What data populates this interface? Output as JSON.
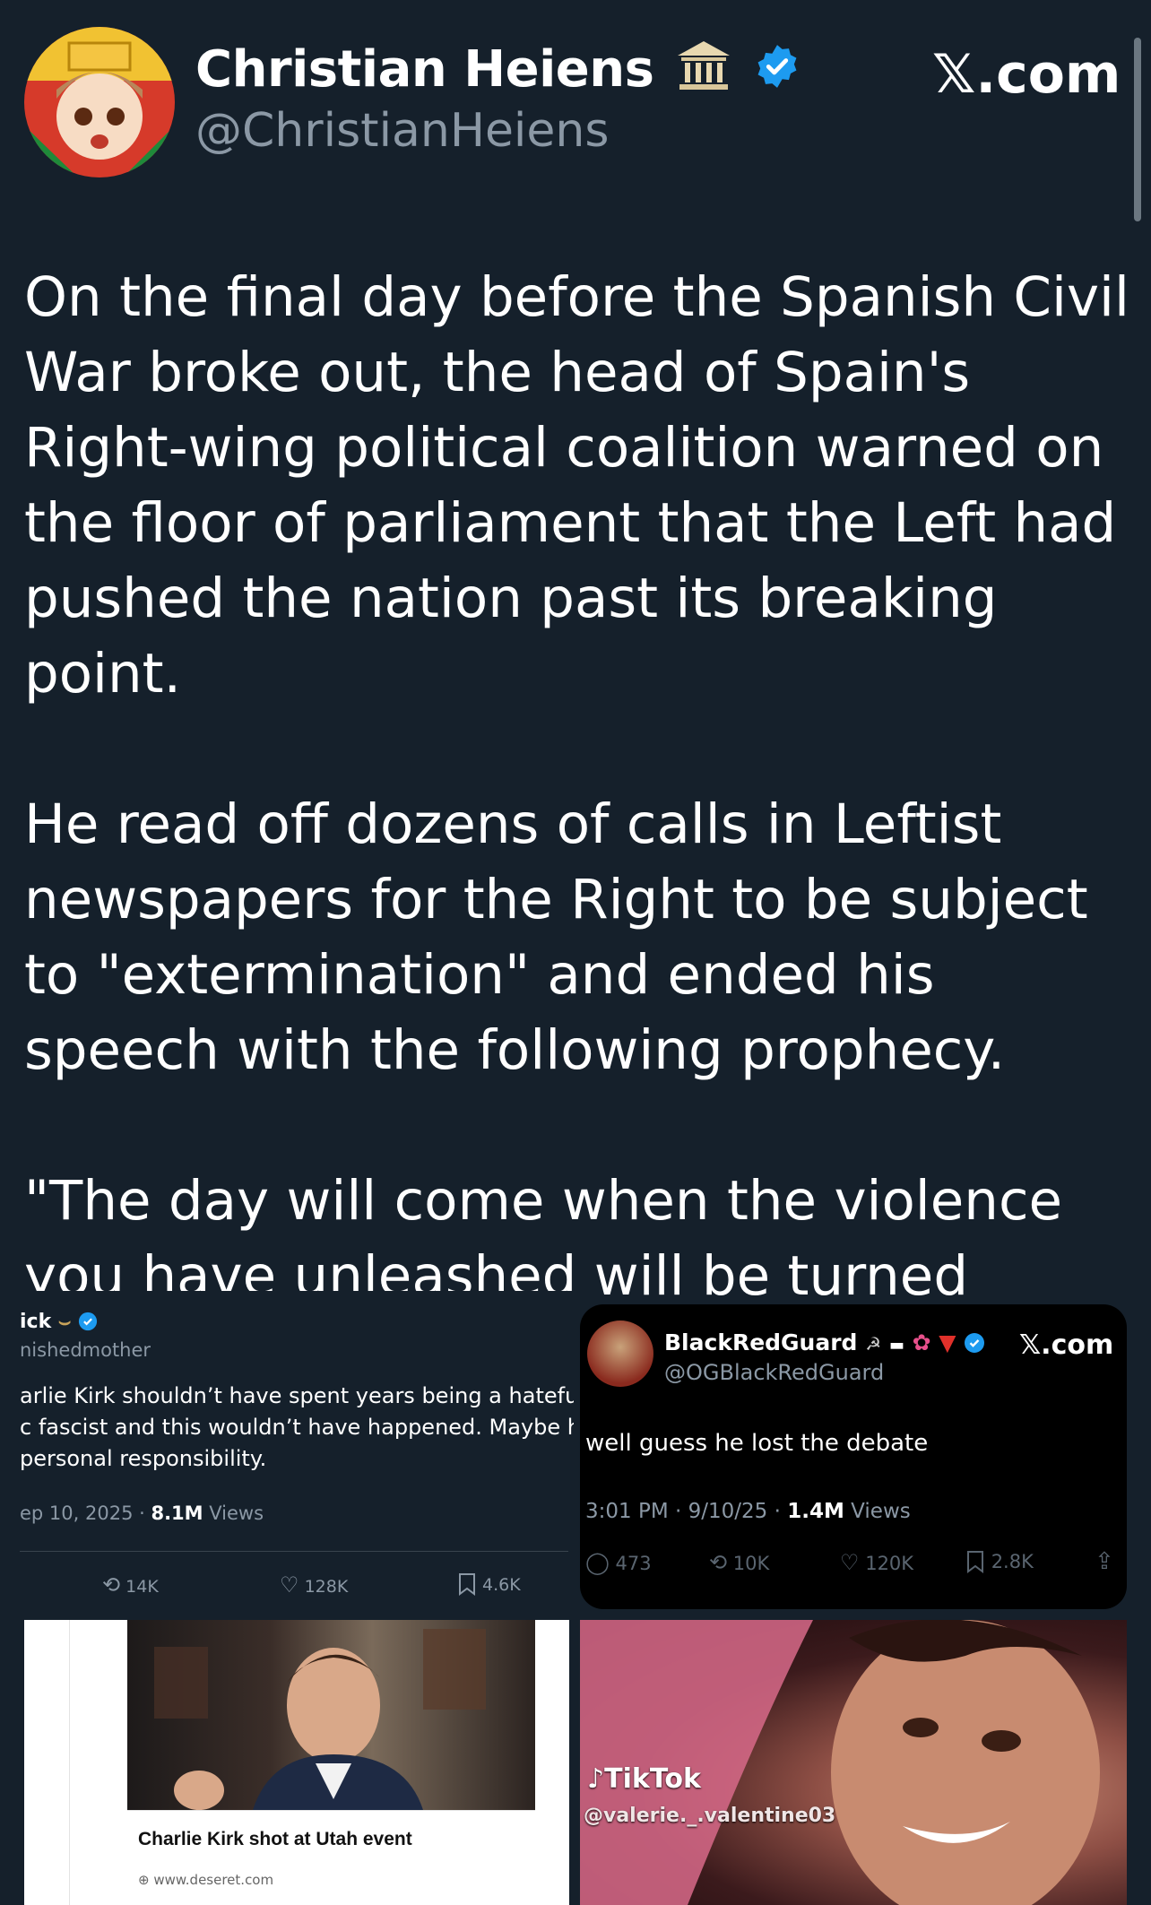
{
  "header": {
    "display_name": "Christian Heiens",
    "handle": "@ChristianHeiens",
    "site": "𝕏.com"
  },
  "tweet": {
    "paragraphs": [
      "On the final day before the Spanish Civil War broke out, the head of Spain's Right-wing political coalition warned on the floor of parliament that the Left had pushed the nation past its breaking point.",
      "He read off dozens of calls in Leftist newspapers for the Right to be subject to \"extermination\" and ended his speech with the following prophecy.",
      "\"The day will come when the violence you have unleashed will be turned against you.\""
    ]
  },
  "embed_left": {
    "name_fragment": "ick",
    "handle_fragment": "nishedmother",
    "text_lines": [
      "arlie Kirk shouldn’t have spent years being a hateful",
      "c fascist and this wouldn’t have happened. Maybe he",
      "personal responsibility."
    ],
    "date": "ep 10, 2025 · ",
    "views_count": "8.1M",
    "views_label": " Views",
    "retweets": "14K",
    "likes": "128K",
    "bookmarks": "4.6K"
  },
  "embed_right": {
    "display_name": "BlackRedGuard",
    "handle": "@OGBlackRedGuard",
    "site": "𝕏.com",
    "text": "well guess he lost the debate",
    "time": "3:01 PM · 9/10/25 · ",
    "views_count": "1.4M",
    "views_label": " Views",
    "replies": "473",
    "retweets": "10K",
    "likes": "120K",
    "bookmarks": "2.8K"
  },
  "news_card": {
    "headline": "Charlie Kirk shot at Utah event",
    "domain": "www.deseret.com"
  },
  "tiktok_card": {
    "brand": "TikTok",
    "handle": "@valerie._.valentine03"
  },
  "colors": {
    "background": "#15202b",
    "muted": "#8b98a5",
    "verified": "#1d9bf0"
  }
}
